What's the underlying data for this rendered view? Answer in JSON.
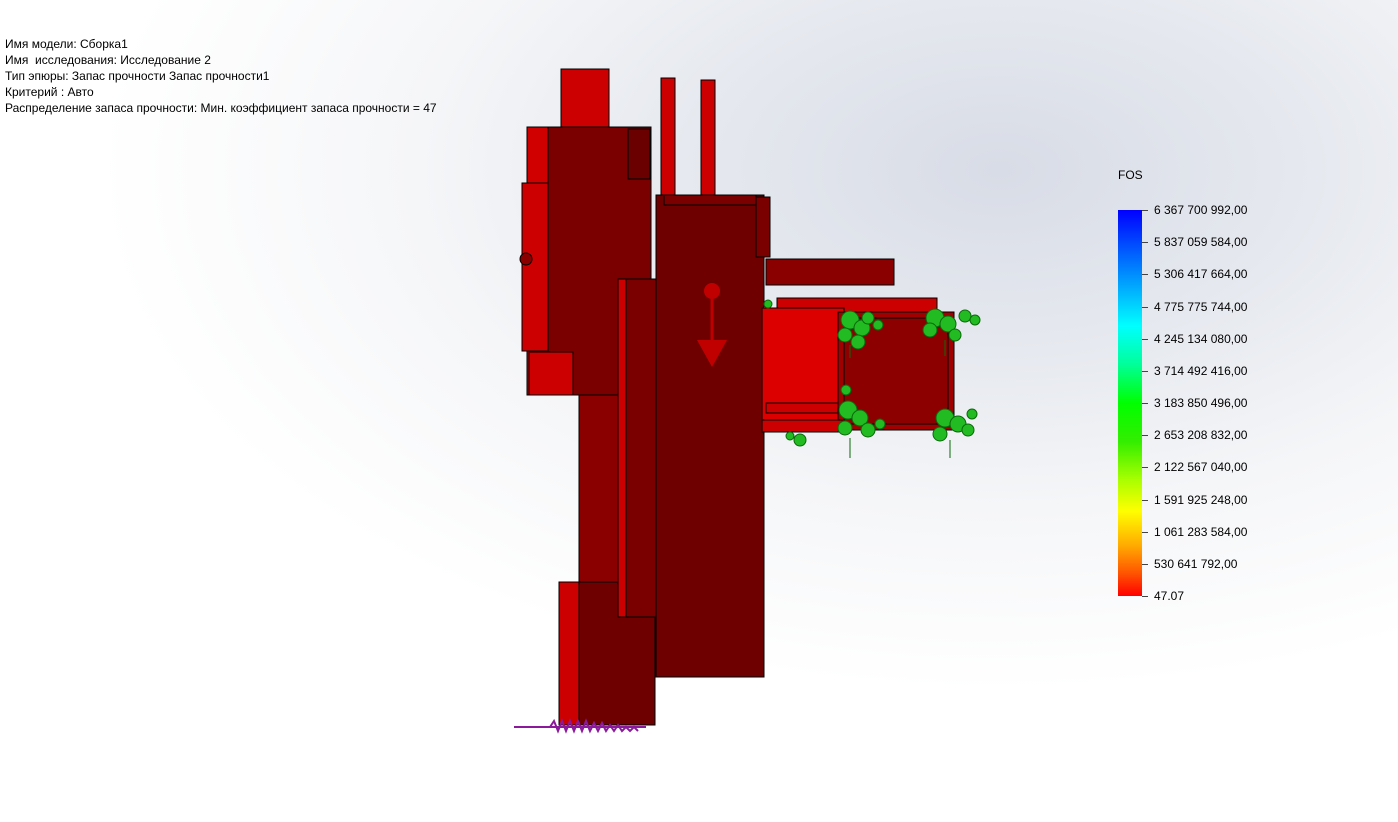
{
  "info": {
    "model_name": "Имя модели: Сборка1",
    "study_name": "Имя  исследования: Исследование 2",
    "plot_type": "Тип эпюры: Запас прочности Запас прочности1",
    "criterion": "Критерий : Авто",
    "distribution": "Распределение запаса прочности: Мин. коэффициент запаса прочности = 47"
  },
  "legend": {
    "title": "FOS",
    "labels": [
      "6 367 700 992,00",
      "5 837 059 584,00",
      "5 306 417 664,00",
      "4 775 775 744,00",
      "4 245 134 080,00",
      "3 714 492 416,00",
      "3 183 850 496,00",
      "2 653 208 832,00",
      "2 122 567 040,00",
      "1 591 925 248,00",
      "1 061 283 584,00",
      "530 641 792,00",
      "47.07"
    ]
  },
  "colors": {
    "part_red": "#cc0000",
    "part_dark": "#6e0000",
    "fixture_green": "#22bb22",
    "load_purple": "#8a1a9a"
  },
  "icons": {
    "fixtures": "fixed-geometry-icon",
    "load": "force-load-icon",
    "gravity": "gravity-arrow-icon"
  }
}
